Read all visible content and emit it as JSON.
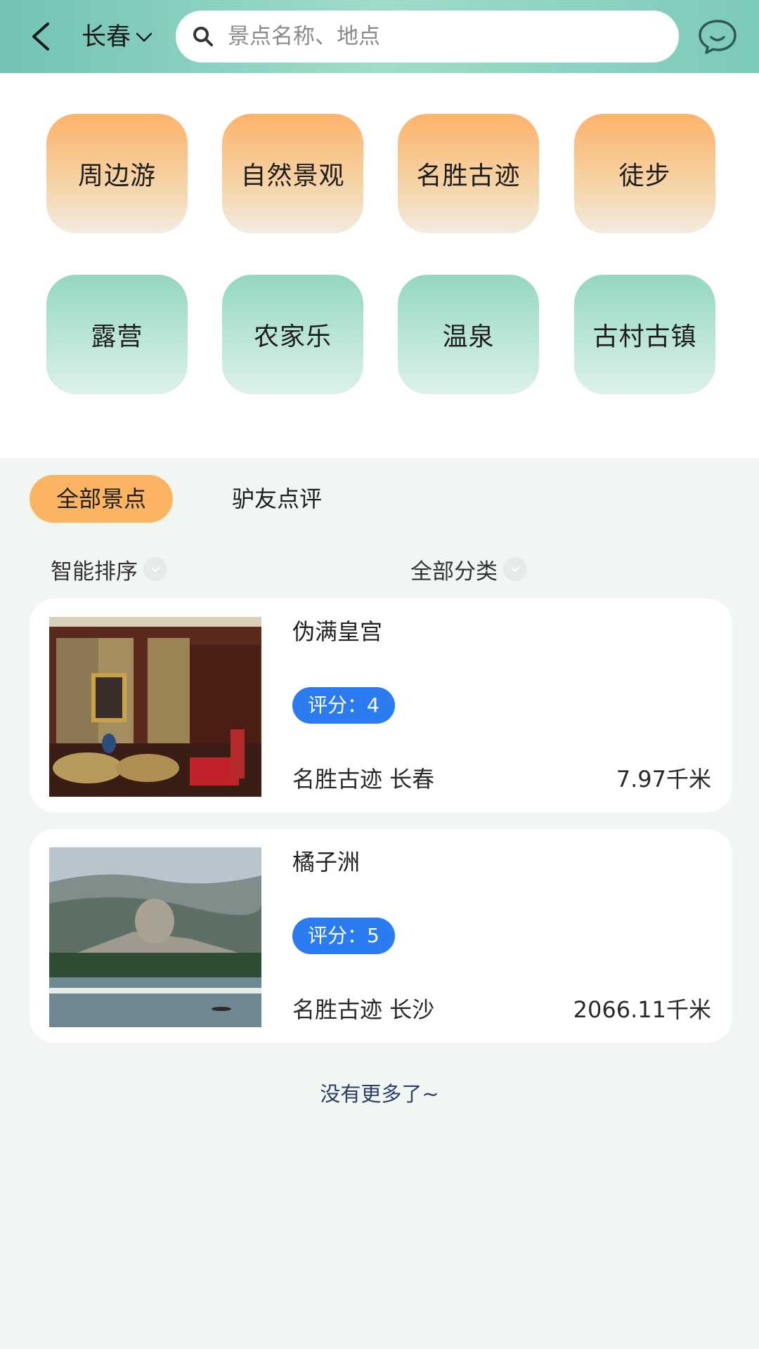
{
  "header": {
    "city": "长春",
    "search_placeholder": "景点名称、地点"
  },
  "categories": [
    {
      "label": "周边游",
      "color": "orange"
    },
    {
      "label": "自然景观",
      "color": "orange"
    },
    {
      "label": "名胜古迹",
      "color": "orange"
    },
    {
      "label": "徒步",
      "color": "orange"
    },
    {
      "label": "露营",
      "color": "green"
    },
    {
      "label": "农家乐",
      "color": "green"
    },
    {
      "label": "温泉",
      "color": "green"
    },
    {
      "label": "古村古镇",
      "color": "green"
    }
  ],
  "tabs": [
    {
      "label": "全部景点",
      "active": true
    },
    {
      "label": "驴友点评",
      "active": false
    }
  ],
  "filters": {
    "sort_label": "智能排序",
    "category_label": "全部分类"
  },
  "spots": [
    {
      "name": "伪满皇宫",
      "rating": "评分：4",
      "meta": "名胜古迹 长春",
      "distance": "7.97千米",
      "image": "palace-interior-photo"
    },
    {
      "name": "橘子洲",
      "rating": "评分：5",
      "meta": "名胜古迹 长沙",
      "distance": "2066.11千米",
      "image": "river-island-statue-photo"
    }
  ],
  "footer_note": "没有更多了~",
  "colors": {
    "header_gradient": "#72c3b5",
    "orange_tile": "#fdb36a",
    "green_tile": "#94d7c3",
    "active_tab": "#fbb562",
    "rating_badge": "#2a7cf0",
    "page_bg": "#f2f6f3"
  }
}
